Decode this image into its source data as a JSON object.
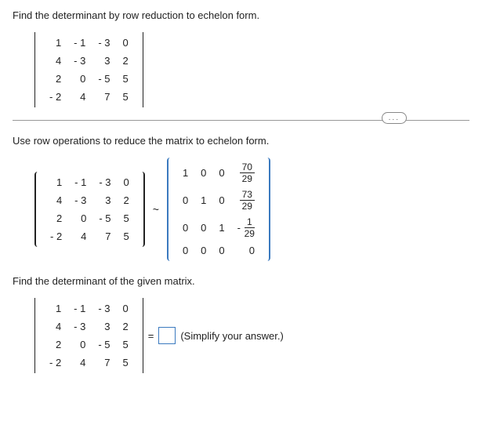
{
  "prompt1": "Find the determinant by row reduction to echelon form.",
  "matrixA": {
    "r1": {
      "c1": "1",
      "c2": "- 1",
      "c3": "- 3",
      "c4": "0"
    },
    "r2": {
      "c1": "4",
      "c2": "- 3",
      "c3": "3",
      "c4": "2"
    },
    "r3": {
      "c1": "2",
      "c2": "0",
      "c3": "- 5",
      "c4": "5"
    },
    "r4": {
      "c1": "- 2",
      "c2": "4",
      "c3": "7",
      "c4": "5"
    }
  },
  "prompt2": "Use row operations to reduce the matrix to echelon form.",
  "echelon": {
    "r1": {
      "c1": "1",
      "c2": "0",
      "c3": "0",
      "frac_num": "70",
      "frac_den": "29"
    },
    "r2": {
      "c1": "0",
      "c2": "1",
      "c3": "0",
      "frac_num": "73",
      "frac_den": "29"
    },
    "r3": {
      "c1": "0",
      "c2": "0",
      "c3": "1",
      "sign": "-",
      "frac_num": "1",
      "frac_den": "29"
    },
    "r4": {
      "c1": "0",
      "c2": "0",
      "c3": "0",
      "c4": "0"
    }
  },
  "prompt3": "Find the determinant of the given matrix.",
  "eq": "=",
  "hint": "(Simplify your answer.)",
  "ellipsis": "..."
}
